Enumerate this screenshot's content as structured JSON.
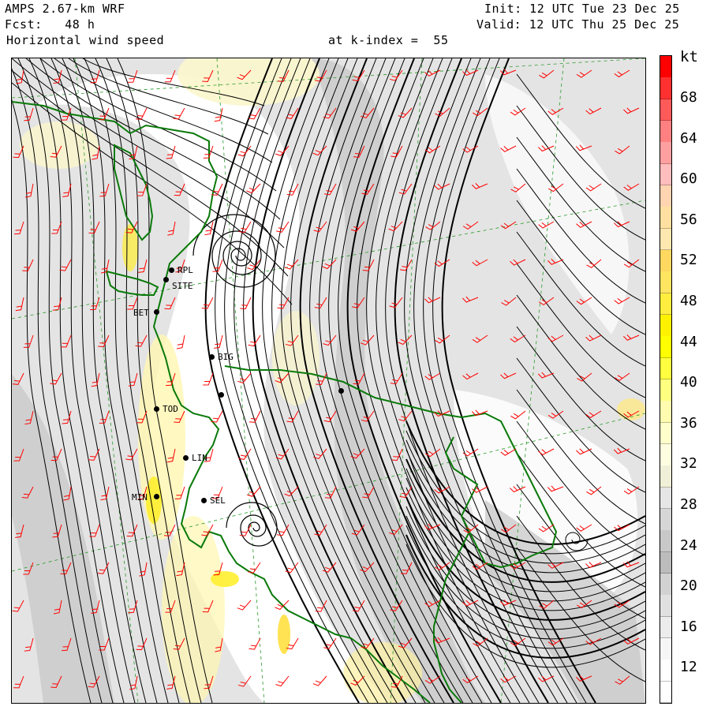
{
  "header": {
    "model": "AMPS 2.67-km WRF",
    "forecast": "Fcst:   48 h",
    "field": "Horizontal wind speed",
    "level": "at k-index =  55",
    "init": "Init: 12 UTC Tue 23 Dec 25",
    "valid": "Valid: 12 UTC Thu 25 Dec 25"
  },
  "colorbar": {
    "unit": "kt",
    "ticks": [
      "68",
      "64",
      "60",
      "56",
      "52",
      "48",
      "44",
      "40",
      "36",
      "32",
      "28",
      "24",
      "20",
      "16",
      "12"
    ],
    "bands": [
      "#ff0000",
      "#ff3030",
      "#ff5a5a",
      "#ff8080",
      "#ffa0a0",
      "#ffbdbd",
      "#ffd4b0",
      "#ffe0a0",
      "#ffe8b0",
      "#ffd860",
      "#ffe560",
      "#ffee40",
      "#fff200",
      "#ffff00",
      "#ffff40",
      "#ffff80",
      "#fffcb0",
      "#ffffcc",
      "#fffde0",
      "#f0f0d8",
      "#e6e6e6",
      "#d6d6d6",
      "#c8c8c8",
      "#bcbcbc",
      "#d2d2d2",
      "#e0e0e0",
      "#ececec",
      "#f6f6f6",
      "#ffffff",
      "#ffffff"
    ]
  },
  "stations": [
    {
      "label": "RPL"
    },
    {
      "label": "SITE"
    },
    {
      "label": "BET"
    },
    {
      "label": "BIG"
    },
    {
      "label": "TOD"
    },
    {
      "label": "LIN"
    },
    {
      "label": "MIN"
    },
    {
      "label": "SEL"
    }
  ],
  "colors": {
    "coastline": "#0a7a0a",
    "streamline": "#000000",
    "barb": "#ff0000",
    "gridline": "#2a9a2a"
  }
}
